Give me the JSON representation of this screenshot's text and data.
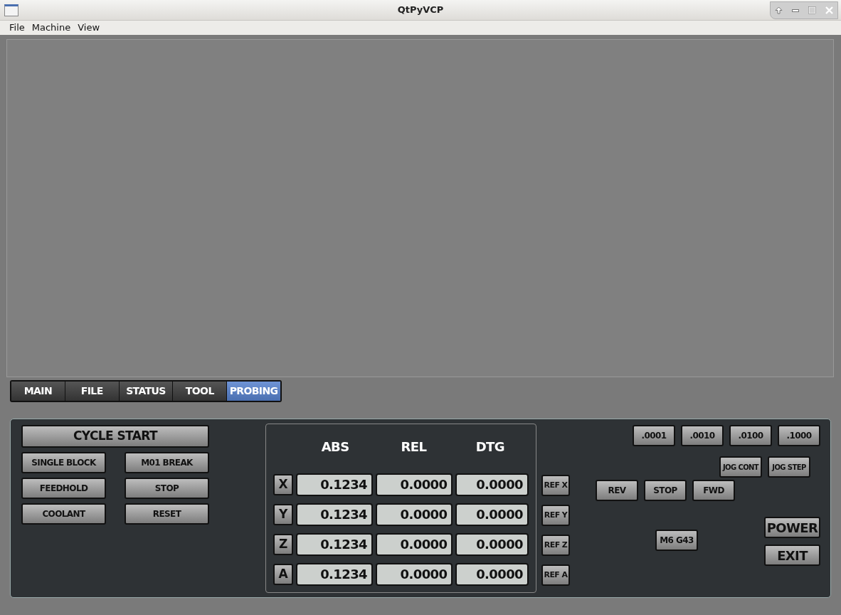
{
  "window": {
    "title": "QtPyVCP"
  },
  "menu": [
    "File",
    "Machine",
    "View"
  ],
  "tabs": [
    {
      "label": "MAIN",
      "selected": false
    },
    {
      "label": "FILE",
      "selected": false
    },
    {
      "label": "STATUS",
      "selected": false
    },
    {
      "label": "TOOL",
      "selected": false
    },
    {
      "label": "PROBING",
      "selected": true
    }
  ],
  "program_controls": {
    "cycle_start": "CYCLE START",
    "buttons": [
      "SINGLE BLOCK",
      "M01 BREAK",
      "FEEDHOLD",
      "STOP",
      "COOLANT",
      "RESET"
    ]
  },
  "dro": {
    "columns": [
      "ABS",
      "REL",
      "DTG"
    ],
    "rows": [
      {
        "axis": "X",
        "abs": "0.1234",
        "rel": "0.0000",
        "dtg": "0.0000",
        "ref": "REF X"
      },
      {
        "axis": "Y",
        "abs": "0.1234",
        "rel": "0.0000",
        "dtg": "0.0000",
        "ref": "REF Y"
      },
      {
        "axis": "Z",
        "abs": "0.1234",
        "rel": "0.0000",
        "dtg": "0.0000",
        "ref": "REF Z"
      },
      {
        "axis": "A",
        "abs": "0.1234",
        "rel": "0.0000",
        "dtg": "0.0000",
        "ref": "REF A"
      }
    ]
  },
  "jog_increments": [
    ".0001",
    ".0010",
    ".0100",
    ".1000"
  ],
  "jog_modes": [
    "JOG CONT",
    "JOG STEP"
  ],
  "spindle": [
    "REV",
    "STOP",
    "FWD"
  ],
  "tool_change": "M6 G43",
  "power": "POWER",
  "exit": "EXIT"
}
